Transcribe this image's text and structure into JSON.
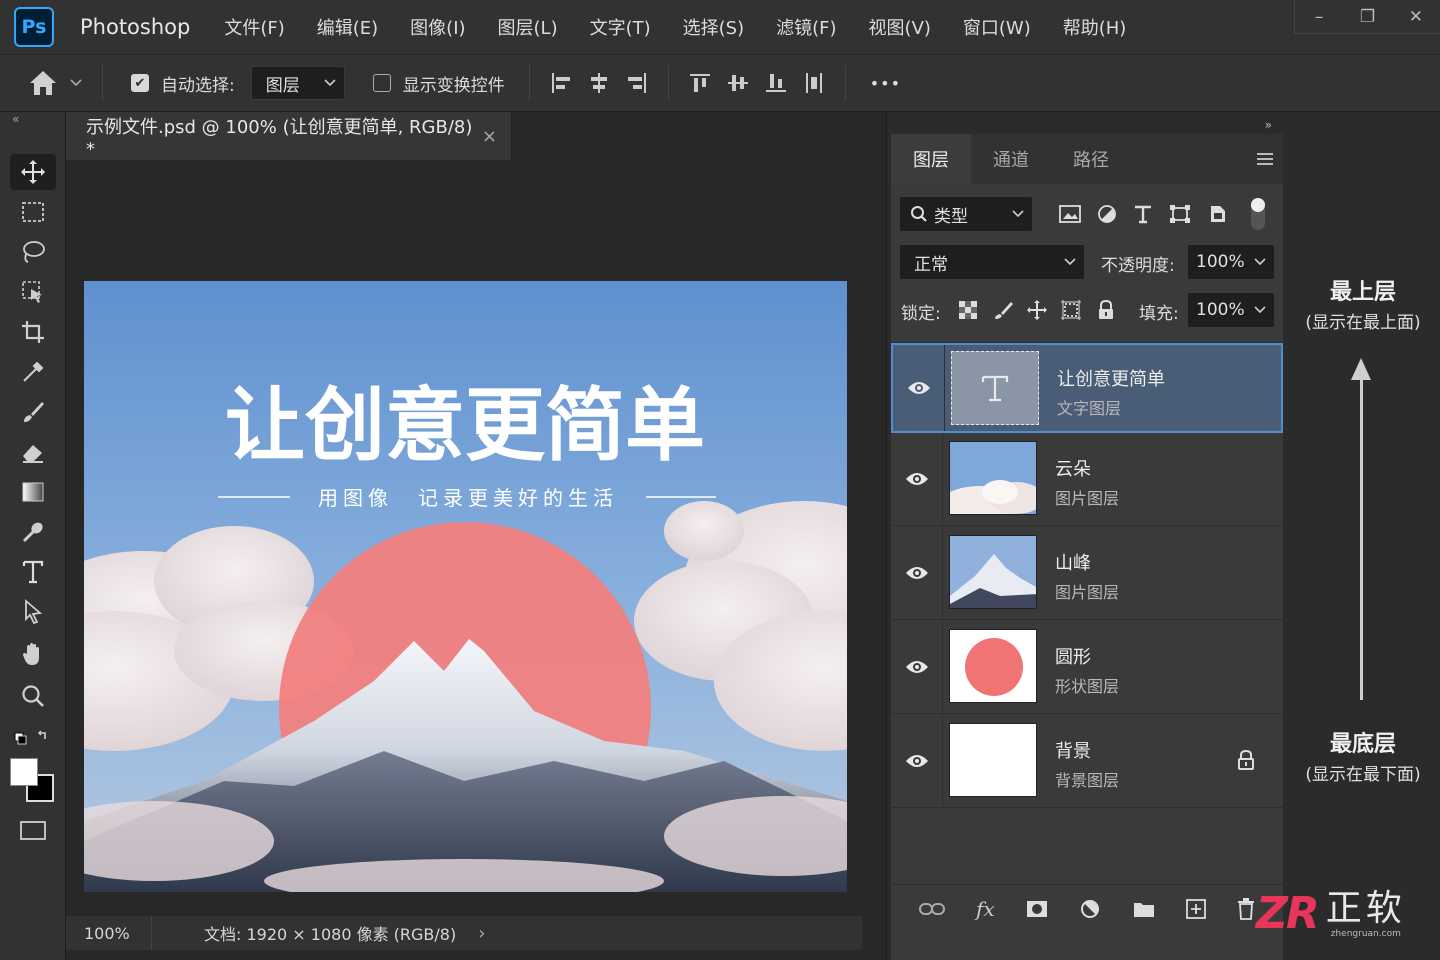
{
  "app": {
    "logo_text": "Ps",
    "title": "Photoshop",
    "menus": [
      "文件(F)",
      "编辑(E)",
      "图像(I)",
      "图层(L)",
      "文字(T)",
      "选择(S)",
      "滤镜(F)",
      "视图(V)",
      "窗口(W)",
      "帮助(H)"
    ]
  },
  "window_controls": {
    "minimize": "–",
    "restore": "❐",
    "close": "✕"
  },
  "options_bar": {
    "auto_select_label": "自动选择:",
    "auto_select_checked": true,
    "auto_select_target": "图层",
    "show_transform_label": "显示变换控件",
    "show_transform_checked": false,
    "more": "•••"
  },
  "document": {
    "tab_title": "示例文件.psd @ 100% (让创意更简单, RGB/8) *",
    "tab_close": "×",
    "canvas_headline": "让创意更简单",
    "canvas_subline": "用图像　记录更美好的生活",
    "circle_color": "#f28080"
  },
  "status": {
    "zoom": "100%",
    "doc_info": "文档:  1920 × 1080 像素 (RGB/8)",
    "arrow": "›"
  },
  "layers_panel": {
    "tabs": [
      "图层",
      "通道",
      "路径"
    ],
    "active_tab": 0,
    "filter_label": "类型",
    "blend_mode": "正常",
    "opacity_label": "不透明度:",
    "opacity_value": "100%",
    "lock_label": "锁定:",
    "fill_label": "填充:",
    "fill_value": "100%",
    "layers": [
      {
        "name": "让创意更简单",
        "type": "文字图层",
        "thumb": "text",
        "selected": true,
        "locked": false
      },
      {
        "name": "云朵",
        "type": "图片图层",
        "thumb": "clouds",
        "selected": false,
        "locked": false
      },
      {
        "name": "山峰",
        "type": "图片图层",
        "thumb": "mountain",
        "selected": false,
        "locked": false
      },
      {
        "name": "圆形",
        "type": "形状图层",
        "thumb": "circle",
        "selected": false,
        "locked": false
      },
      {
        "name": "背景",
        "type": "背景图层",
        "thumb": "white",
        "selected": false,
        "locked": true
      }
    ],
    "bottom_fx": "fx"
  },
  "annotation": {
    "top_title": "最上层",
    "top_sub": "(显示在最上面)",
    "bottom_title": "最底层",
    "bottom_sub": "(显示在最下面)"
  },
  "watermark": {
    "logo": "ZR",
    "name": "正软",
    "url": "zhengruan.com"
  }
}
